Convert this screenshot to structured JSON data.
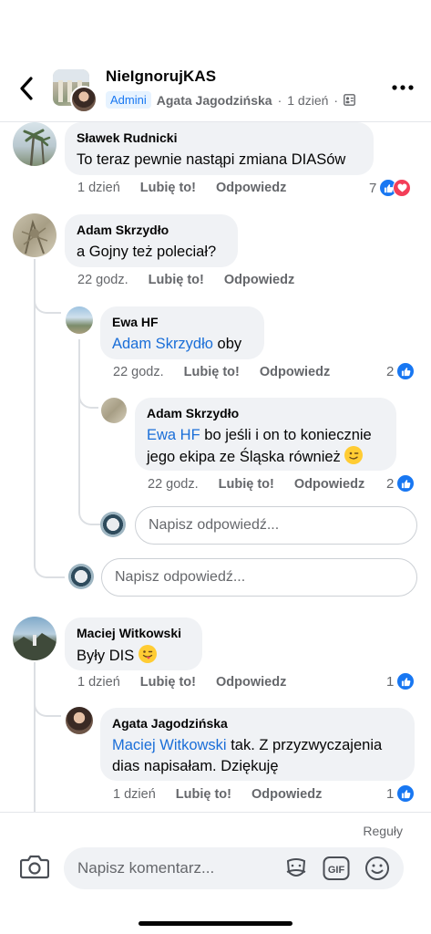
{
  "header": {
    "group_name": "NieIgnorujKAS",
    "admin_badge": "Admini",
    "author": "Agata Jagodzińska",
    "separator": "·",
    "time": "1 dzień",
    "separator2": "·",
    "icons": {
      "back": "chevron-left-icon",
      "more": "more-dots-icon",
      "audience": "group-members-icon"
    }
  },
  "comments": [
    {
      "name": "Sławek Rudnicki",
      "text": "To teraz pewnie nastąpi zmiana DIASów",
      "time": "1 dzień",
      "like": "Lubię to!",
      "reply": "Odpowiedz",
      "reactions_count": "7",
      "reactions": [
        "like",
        "love"
      ]
    },
    {
      "name": "Adam Skrzydło",
      "text": "a Gojny też poleciał?",
      "time": "22 godz.",
      "like": "Lubię to!",
      "reply": "Odpowiedz",
      "replies": [
        {
          "name": "Ewa HF",
          "mention": "Adam Skrzydło",
          "text": " oby",
          "time": "22 godz.",
          "like": "Lubię to!",
          "reply": "Odpowiedz",
          "reactions_count": "2"
        },
        {
          "name": "Adam Skrzydło",
          "mention": "Ewa HF",
          "text": " bo jeśli i on to koniecznie",
          "text_line2": "jego ekipa ze Śląska również ",
          "emoji": "wink-emoji",
          "time": "22 godz.",
          "like": "Lubię to!",
          "reply": "Odpowiedz",
          "reactions_count": "2"
        }
      ],
      "nested_reply_placeholder": "Napisz odpowiedź...",
      "reply_placeholder": "Napisz odpowiedź..."
    },
    {
      "name": "Maciej Witkowski",
      "text": "Były DIS ",
      "emoji": "tongue-wink-emoji",
      "time": "1 dzień",
      "like": "Lubię to!",
      "reply": "Odpowiedz",
      "reactions_count": "1",
      "replies": [
        {
          "name": "Agata Jagodzińska",
          "mention": "Maciej Witkowski",
          "text": " tak. Z przyzwyczajenia",
          "text_line2": "dias napisałam. Dziękuję",
          "time": "1 dzień",
          "like": "Lubię to!",
          "reply": "Odpowiedz",
          "reactions_count": "1"
        }
      ]
    }
  ],
  "footer": {
    "rules": "Reguły",
    "compose_placeholder": "Napisz komentarz...",
    "gif_label": "GIF",
    "icons": [
      "camera-icon",
      "sticker-icon",
      "gif-icon",
      "emoji-icon"
    ]
  },
  "colors": {
    "accent": "#1877f2",
    "mention": "#1a6ed8",
    "bubble": "#f0f2f5",
    "secondary_text": "#65676b",
    "love": "#f33e58"
  }
}
